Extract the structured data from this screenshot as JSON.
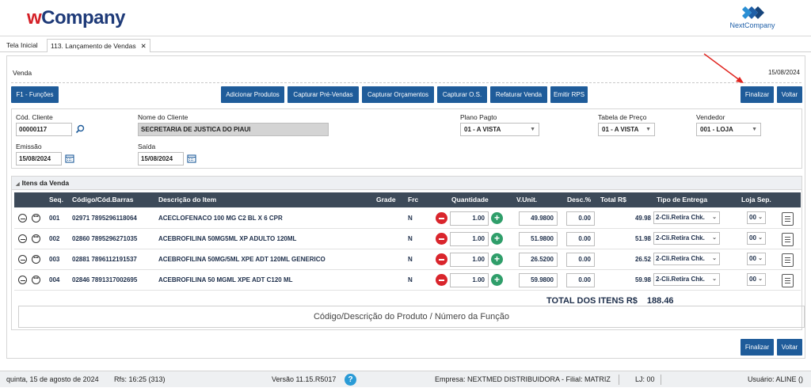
{
  "header": {
    "brand_w": "w",
    "brand_rest": "Company",
    "partner": "NextCompany"
  },
  "tabs": [
    {
      "label": "Tela Inicial"
    },
    {
      "label": "113. Lançamento de Vendas",
      "close": "✕"
    }
  ],
  "venda": {
    "title": "Venda",
    "date": "15/08/2024"
  },
  "toolbar": {
    "functions": "F1 - Funções",
    "add_products": "Adicionar Produtos",
    "pre_sales": "Capturar Pré-Vendas",
    "quotes": "Capturar Orçamentos",
    "service_orders": "Capturar O.S.",
    "rebill": "Refaturar Venda",
    "emit_rps": "Emitir RPS",
    "finalize": "Finalizar",
    "back": "Voltar"
  },
  "form": {
    "client_code_label": "Cód. Cliente",
    "client_code": "00000117",
    "client_name_label": "Nome do Cliente",
    "client_name": "SECRETARIA DE JUSTICA DO PIAUI",
    "payment_plan_label": "Plano Pagto",
    "payment_plan": "01 - A VISTA",
    "price_table_label": "Tabela de Preço",
    "price_table": "01 - A VISTA",
    "seller_label": "Vendedor",
    "seller": "001 - LOJA",
    "issue_label": "Emissão",
    "issue_date": "15/08/2024",
    "exit_label": "Saída",
    "exit_date": "15/08/2024"
  },
  "items": {
    "section_title": "Itens da Venda",
    "columns": [
      "Seq.",
      "Código/Cód.Barras",
      "Descrição do Item",
      "Grade",
      "Frc",
      "Quantidade",
      "V.Unit.",
      "Desc.%",
      "Total R$",
      "Tipo de Entrega",
      "Loja Sep."
    ],
    "rows": [
      {
        "seq": "001",
        "code": "02971 7895296118064",
        "desc": "ACECLOFENACO 100 MG C2 BL X 6 CPR",
        "frc": "N",
        "qty": "1.00",
        "unit": "49.9800",
        "disc": "0.00",
        "total": "49.98",
        "delivery": "2-Cli.Retira Chk.",
        "store": "00"
      },
      {
        "seq": "002",
        "code": "02860 7895296271035",
        "desc": "ACEBROFILINA 50MG5ML XP ADULTO 120ML",
        "frc": "N",
        "qty": "1.00",
        "unit": "51.9800",
        "disc": "0.00",
        "total": "51.98",
        "delivery": "2-Cli.Retira Chk.",
        "store": "00"
      },
      {
        "seq": "003",
        "code": "02881 7896112191537",
        "desc": "ACEBROFILINA 50MG/5ML XPE ADT 120ML GENERICO",
        "frc": "N",
        "qty": "1.00",
        "unit": "26.5200",
        "disc": "0.00",
        "total": "26.52",
        "delivery": "2-Cli.Retira Chk.",
        "store": "00"
      },
      {
        "seq": "004",
        "code": "02846 7891317002695",
        "desc": "ACEBROFILINA 50 MGML XPE ADT C120 ML",
        "frc": "N",
        "qty": "1.00",
        "unit": "59.9800",
        "disc": "0.00",
        "total": "59.98",
        "delivery": "2-Cli.Retira Chk.",
        "store": "00"
      }
    ],
    "total_label": "TOTAL DOS ITENS R$",
    "total_value": "188.46",
    "search_placeholder": "Código/Descrição do Produto / Número da Função"
  },
  "footer": {
    "finalize": "Finalizar",
    "back": "Voltar"
  },
  "status": {
    "date": "quinta, 15 de agosto de 2024",
    "rfs": "Rfs: 16:25 (313)",
    "version": "Versão 11.15.R5017",
    "help": "?",
    "company": "Empresa: NEXTMED DISTRIBUIDORA - Filial: MATRIZ",
    "lj": "LJ: 00",
    "user": "Usuário: ALINE ()"
  },
  "colors": {
    "primary": "#1f5c9a",
    "table_header": "#3d4a59",
    "danger": "#d9252c",
    "success": "#2f9e6a",
    "brand_red": "#d42027",
    "brand_blue": "#1e3a78"
  }
}
